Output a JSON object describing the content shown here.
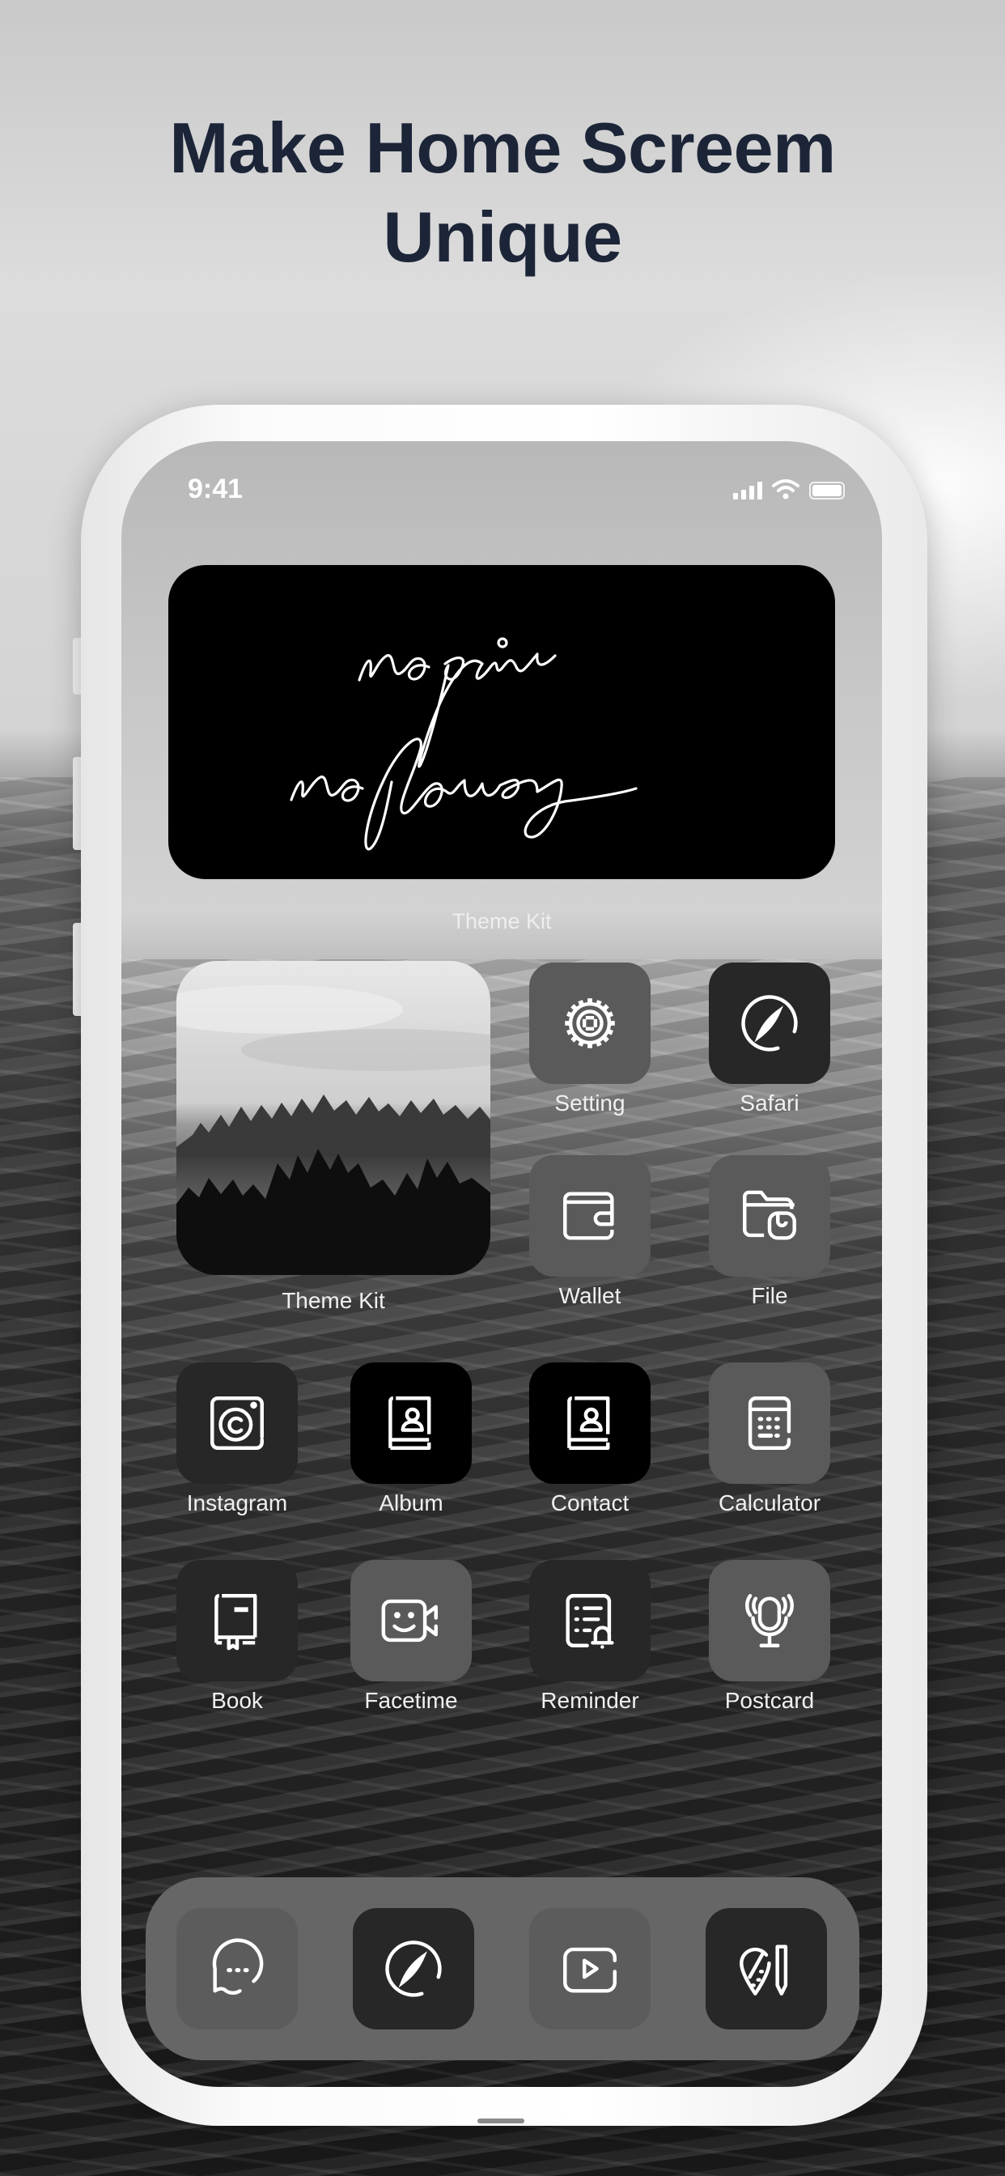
{
  "headline": {
    "line1": "Make Home Screem",
    "line2": "Unique"
  },
  "status_bar": {
    "time": "9:41",
    "icons": [
      "cellular-signal-icon",
      "wifi-icon",
      "battery-icon"
    ]
  },
  "quote_widget": {
    "line1": "no pain",
    "line2": "no flowers",
    "label": "Theme Kit"
  },
  "photo_widget": {
    "label": "Theme Kit",
    "image": "misty-forest-photo"
  },
  "apps": [
    {
      "label": "Setting",
      "icon": "settings-gear-icon",
      "tone": "mid"
    },
    {
      "label": "Safari",
      "icon": "compass-icon",
      "tone": "dark"
    },
    {
      "label": "Wallet",
      "icon": "wallet-icon",
      "tone": "mid"
    },
    {
      "label": "File",
      "icon": "folder-icon",
      "tone": "mid"
    },
    {
      "label": "Instagram",
      "icon": "camera-icon",
      "tone": "dark"
    },
    {
      "label": "Album",
      "icon": "contact-book-icon",
      "tone": "black"
    },
    {
      "label": "Contact",
      "icon": "contact-book-icon",
      "tone": "black"
    },
    {
      "label": "Calculator",
      "icon": "calculator-icon",
      "tone": "mid"
    },
    {
      "label": "Book",
      "icon": "book-icon",
      "tone": "dark"
    },
    {
      "label": "Facetime",
      "icon": "video-smile-icon",
      "tone": "mid"
    },
    {
      "label": "Reminder",
      "icon": "reminder-list-bell-icon",
      "tone": "dark"
    },
    {
      "label": "Postcard",
      "icon": "podcast-mic-icon",
      "tone": "mid"
    }
  ],
  "dock": [
    {
      "icon": "message-bubble-icon",
      "tone": "dockmid"
    },
    {
      "icon": "compass-icon",
      "tone": "dark"
    },
    {
      "icon": "video-play-icon",
      "tone": "dockmid"
    },
    {
      "icon": "map-pin-pencil-icon",
      "tone": "dark"
    }
  ]
}
